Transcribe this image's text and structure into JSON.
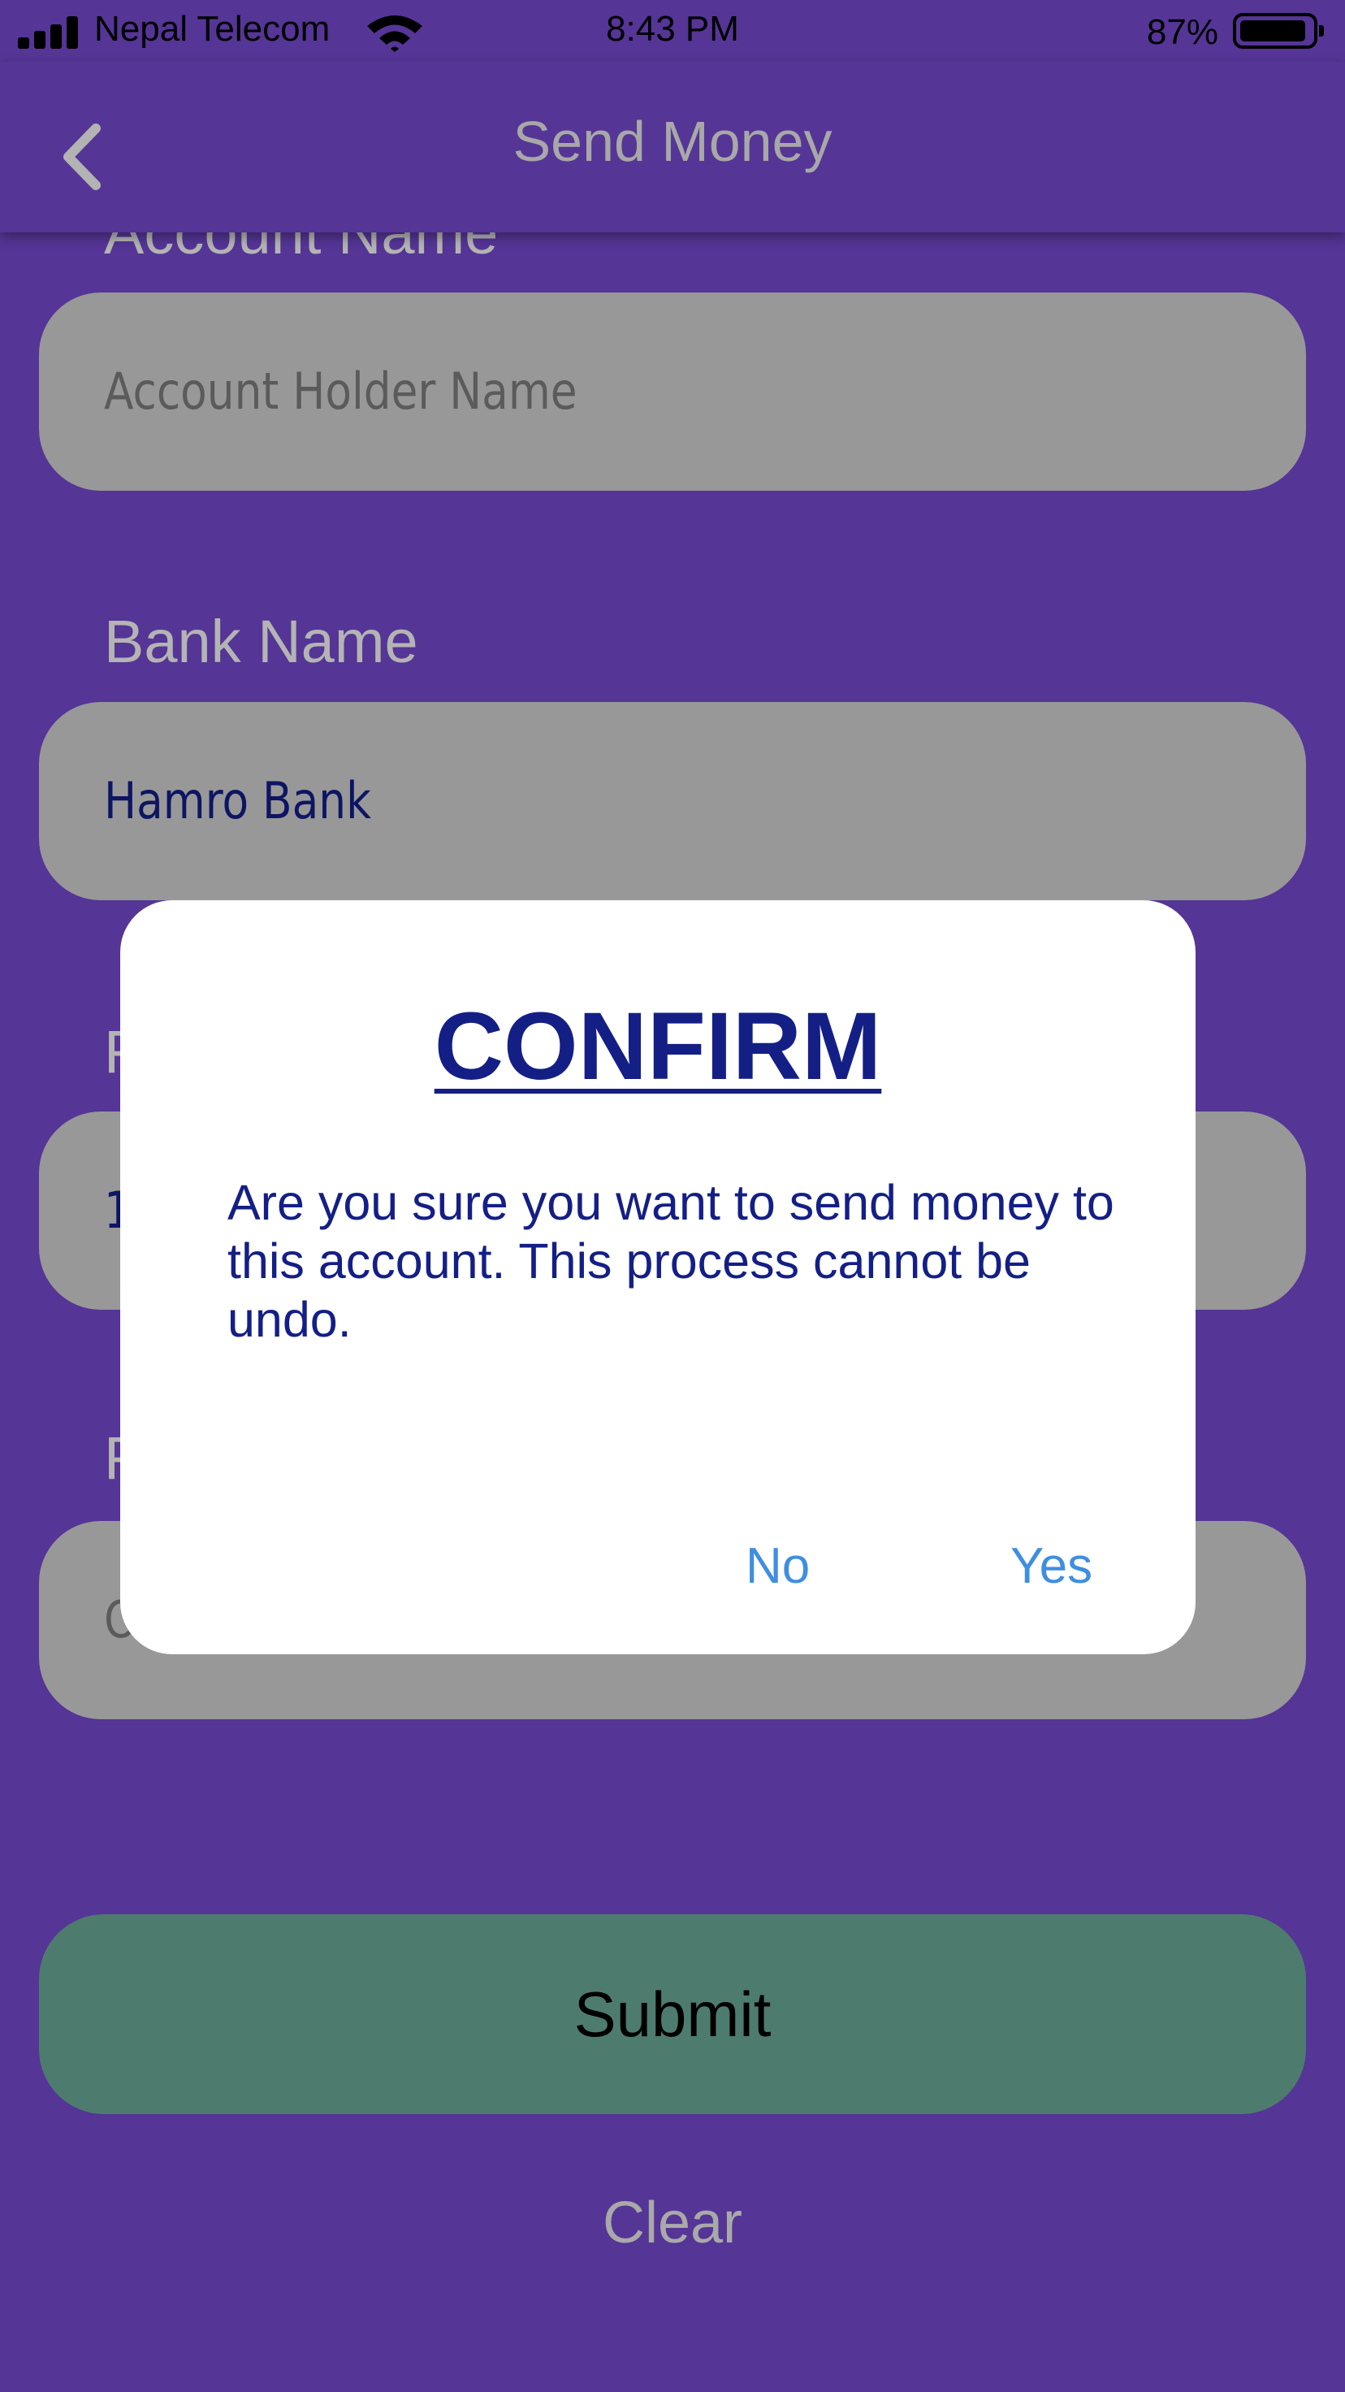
{
  "status_bar": {
    "carrier": "Nepal Telecom",
    "time": "8:43 PM",
    "battery_percent": "87%",
    "battery_level": 0.87,
    "icons": [
      "cellular-signal-icon",
      "wifi-icon",
      "battery-icon"
    ]
  },
  "navbar": {
    "title": "Send Money",
    "back_icon": "chevron-left-icon"
  },
  "form": {
    "fields": [
      {
        "label": "Account Name",
        "value": "",
        "placeholder": "Account Holder Name"
      },
      {
        "label": "Bank Name",
        "value": "Hamro Bank",
        "placeholder": ""
      },
      {
        "label": "F",
        "value": "1",
        "placeholder": ""
      },
      {
        "label": "F",
        "value": "",
        "placeholder": "O"
      }
    ],
    "submit_label": "Submit",
    "clear_label": "Clear"
  },
  "dialog": {
    "title": "CONFIRM",
    "message": "Are you sure you want to send money to this account. This process cannot be undo.",
    "no_label": "No",
    "yes_label": "Yes"
  },
  "colors": {
    "background": "#553596",
    "field_background": "#989898",
    "submit_background": "#4d7c6e",
    "dialog_text": "#141f86",
    "dialog_button_text": "#3f8ee0"
  }
}
